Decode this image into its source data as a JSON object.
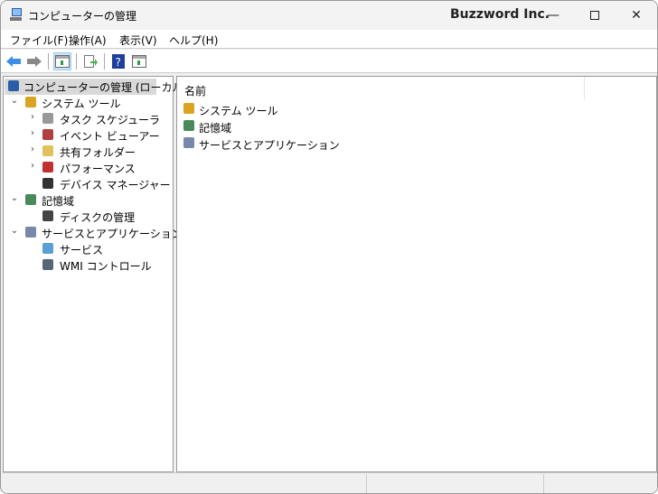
{
  "window": {
    "title": "コンピューターの管理",
    "brand": "Buzzword Inc.",
    "minimize_icon": "minimize-icon",
    "maximize_icon": "maximize-icon",
    "close_icon": "close-icon"
  },
  "menu": [
    "ファイル(F)",
    "操作(A)",
    "表示(V)",
    "ヘルプ(H)"
  ],
  "toolbar": [
    "back-icon",
    "forward-icon",
    "show-hide-console-tree-icon",
    "export-list-icon",
    "help-icon",
    "show-action-pane-icon"
  ],
  "tree": [
    {
      "label": "コンピューターの管理 (ローカル)",
      "level": 0,
      "icon": "computer-management-icon",
      "selected": true
    },
    {
      "label": "システム ツール",
      "level": 1,
      "expanded": true,
      "icon": "tools-icon"
    },
    {
      "label": "タスク スケジューラ",
      "level": 2,
      "collapsed": true,
      "icon": "clock-icon"
    },
    {
      "label": "イベント ビューアー",
      "level": 2,
      "collapsed": true,
      "icon": "event-viewer-icon"
    },
    {
      "label": "共有フォルダー",
      "level": 2,
      "collapsed": true,
      "icon": "shared-folder-icon"
    },
    {
      "label": "パフォーマンス",
      "level": 2,
      "collapsed": true,
      "icon": "performance-icon"
    },
    {
      "label": "デバイス マネージャー",
      "level": 2,
      "icon": "device-manager-icon"
    },
    {
      "label": "記憶域",
      "level": 1,
      "expanded": true,
      "icon": "storage-icon"
    },
    {
      "label": "ディスクの管理",
      "level": 2,
      "icon": "disk-icon"
    },
    {
      "label": "サービスとアプリケーション",
      "level": 1,
      "expanded": true,
      "icon": "services-apps-icon"
    },
    {
      "label": "サービス",
      "level": 2,
      "icon": "gear-icon"
    },
    {
      "label": "WMI コントロール",
      "level": 2,
      "icon": "wmi-icon"
    }
  ],
  "list": {
    "column_header": "名前",
    "items": [
      {
        "label": "システム ツール",
        "icon": "tools-icon"
      },
      {
        "label": "記憶域",
        "icon": "storage-icon"
      },
      {
        "label": "サービスとアプリケーション",
        "icon": "services-apps-icon"
      }
    ]
  },
  "colors": {
    "selection": "#d9d9d9",
    "toolbar_active": "#cce4f7",
    "back_arrow": "#3a8ee6"
  }
}
